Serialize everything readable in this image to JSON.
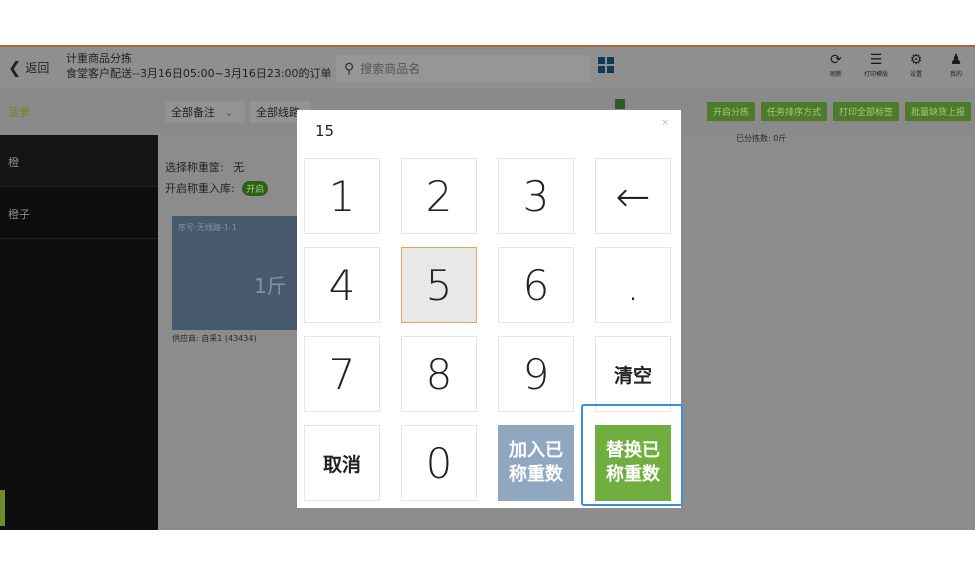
{
  "header": {
    "back_label": "返回",
    "title": "计重商品分拣",
    "subtitle": "食堂客户配送--3月16日05:00~3月16日23:00的订单",
    "search_placeholder": "搜索商品名",
    "tools": [
      {
        "icon": "refresh-icon",
        "label": "刷新"
      },
      {
        "icon": "print-template-icon",
        "label": "打印模版"
      },
      {
        "icon": "gear-icon",
        "label": "设置"
      },
      {
        "icon": "user-icon",
        "label": "我的"
      }
    ]
  },
  "toolbar": {
    "category": "菠萝",
    "filter_notes": "全部备注",
    "filter_routes": "全部线路",
    "actions": [
      "开启分拣",
      "任务排序方式",
      "打印全部标签",
      "批量缺货上报"
    ],
    "sorted_count": "已分拣数: 0斤"
  },
  "sidebar": {
    "items": [
      {
        "label": "橙"
      },
      {
        "label": "橙子"
      }
    ]
  },
  "content": {
    "scale_label": "选择称重筐:",
    "scale_value": "无",
    "stockin_label": "开启称重入库:",
    "stockin_toggle": "开启",
    "card": {
      "seq": "序号-无线路-1-1",
      "weight": "1斤"
    },
    "supplier": "供应商: 自采1 (43434)"
  },
  "keypad": {
    "display_value": "15",
    "close": "×",
    "keys": [
      "1",
      "2",
      "3",
      "←",
      "4",
      "5",
      "6",
      ".",
      "7",
      "8",
      "9",
      "清空",
      "取消",
      "0"
    ],
    "add_weighed_line1": "加入已",
    "add_weighed_line2": "称重数",
    "replace_weighed_line1": "替换已",
    "replace_weighed_line2": "称重数",
    "active_key": "5"
  },
  "colors": {
    "accent_green": "#6fae3f",
    "key_blue": "#8fa8bf",
    "focus_blue": "#3a8fd9",
    "active_key_border": "#e2a650"
  }
}
